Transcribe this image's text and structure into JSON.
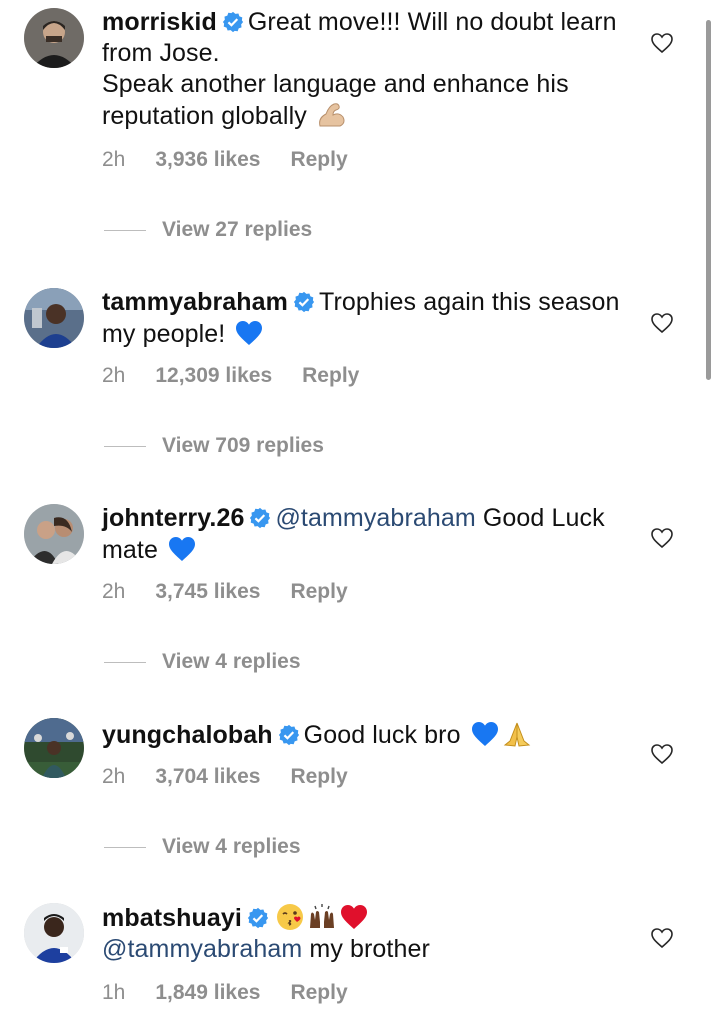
{
  "comments": [
    {
      "username": "morriskid",
      "text": "Great move!!! Will no doubt learn from Jose.",
      "text2": "Speak another language and enhance his reputation globally",
      "emoji": "flexed-biceps-icon",
      "time": "2h",
      "likes": "3,936 likes",
      "reply": "Reply",
      "view_replies": "View 27 replies"
    },
    {
      "username": "tammyabraham",
      "text": "Trophies again this season my people!",
      "emoji": "blue-heart-icon",
      "time": "2h",
      "likes": "12,309 likes",
      "reply": "Reply",
      "view_replies": "View 709 replies"
    },
    {
      "username": "johnterry.26",
      "mention": "@tammyabraham",
      "text": "Good Luck mate",
      "emoji": "blue-heart-icon",
      "time": "2h",
      "likes": "3,745 likes",
      "reply": "Reply",
      "view_replies": "View 4 replies"
    },
    {
      "username": "yungchalobah",
      "text": "Good luck bro",
      "emojis": [
        "blue-heart-icon",
        "folded-hands-icon"
      ],
      "time": "2h",
      "likes": "3,704 likes",
      "reply": "Reply",
      "view_replies": "View 4 replies"
    },
    {
      "username": "mbatshuayi",
      "emojis": [
        "kissing-face-icon",
        "raising-hands-icon",
        "red-heart-icon"
      ],
      "mention": "@tammyabraham",
      "text": "my brother",
      "time": "1h",
      "likes": "1,849 likes",
      "reply": "Reply"
    }
  ],
  "colors": {
    "text": "#111111",
    "secondary": "#8e8e8e",
    "mention": "#2b4a73",
    "verified": "#3897f0",
    "blue_heart": "#1877f2",
    "red_heart": "#e0102c"
  }
}
